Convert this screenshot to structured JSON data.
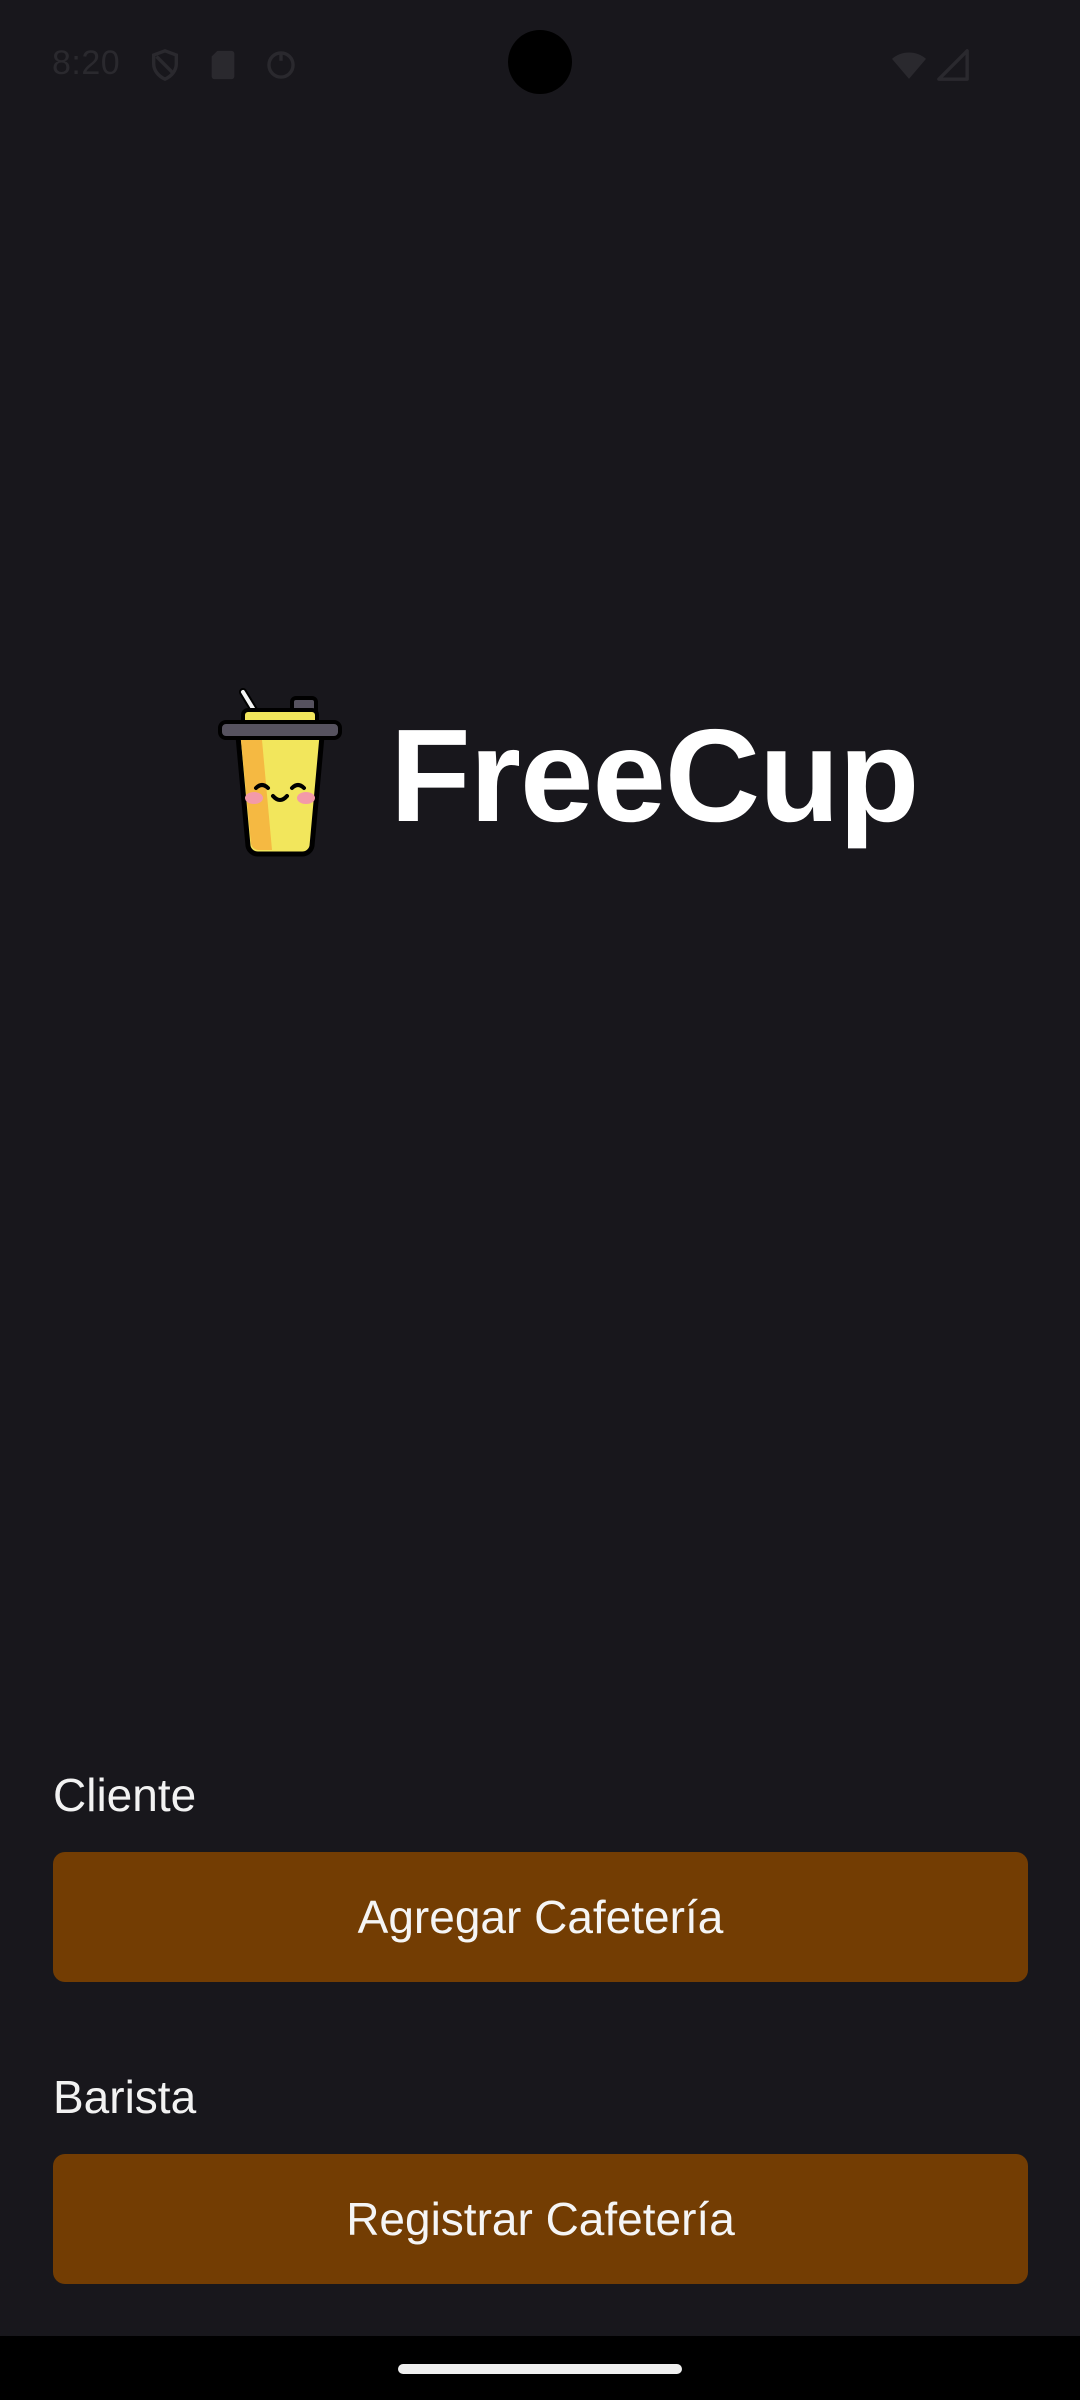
{
  "status_bar": {
    "time": "8:20",
    "icons_left": [
      "shield-icon",
      "sd-card-icon",
      "sync-circle-icon"
    ],
    "icons_right": [
      "wifi-icon",
      "signal-icon"
    ]
  },
  "app": {
    "name": "FreeCup",
    "logo_icon": "cup-with-straw-icon"
  },
  "cliente": {
    "label": "Cliente",
    "button_label": "Agregar Cafetería"
  },
  "barista": {
    "label": "Barista",
    "button_label": "Registrar Cafetería"
  },
  "colors": {
    "background": "#18171c",
    "button": "#733d03",
    "text": "#ffffff",
    "cup_body": "#f2e65c",
    "cup_lid": "#56525f"
  }
}
